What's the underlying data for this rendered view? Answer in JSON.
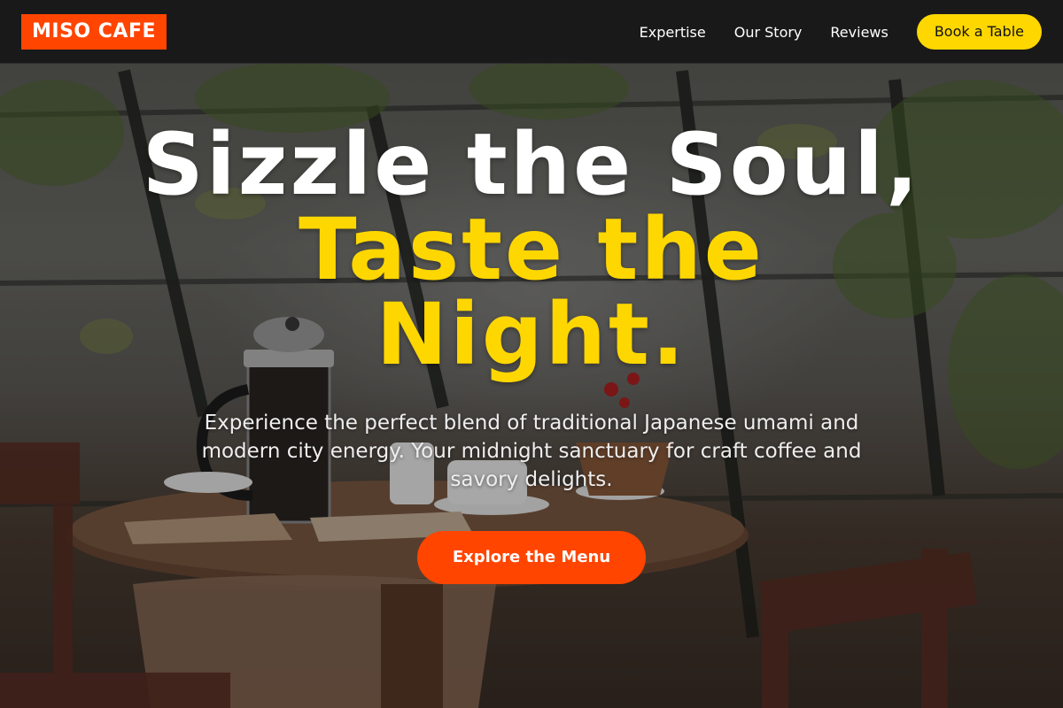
{
  "header": {
    "logo": "MISO CAFE",
    "nav": [
      {
        "label": "Expertise"
      },
      {
        "label": "Our Story"
      },
      {
        "label": "Reviews"
      }
    ],
    "book_label": "Book a Table"
  },
  "hero": {
    "headline_line1": "Sizzle the Soul,",
    "headline_accent": "Taste the Night.",
    "subtext": "Experience the perfect blend of traditional Japanese umami and modern city energy. Your midnight sanctuary for craft coffee and savory delights.",
    "cta_label": "Explore the Menu"
  },
  "colors": {
    "brand_orange": "#ff4500",
    "accent_yellow": "#ffd700",
    "header_bg": "#181818"
  }
}
